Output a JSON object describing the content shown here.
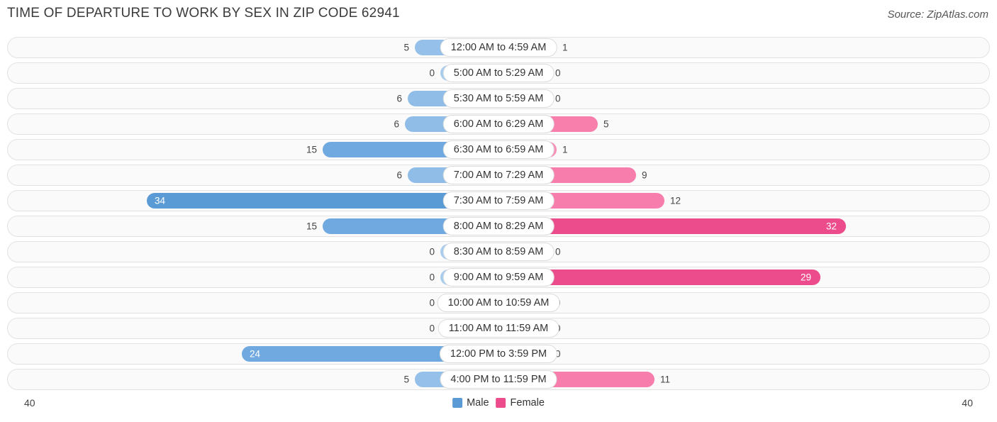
{
  "header": {
    "title": "TIME OF DEPARTURE TO WORK BY SEX IN ZIP CODE 62941",
    "source": "Source: ZipAtlas.com"
  },
  "legend": {
    "male_label": "Male",
    "female_label": "Female",
    "male_color": "#5b9bd5",
    "female_color": "#ed4c8c"
  },
  "axis": {
    "left_max": "40",
    "right_max": "40"
  },
  "chart_data": {
    "type": "bar",
    "subtype": "diverging-bidirectional",
    "title": "TIME OF DEPARTURE TO WORK BY SEX IN ZIP CODE 62941",
    "xlabel": "",
    "ylabel": "",
    "xlim": [
      40,
      40
    ],
    "grid": false,
    "legend_position": "bottom-center",
    "categories": [
      "12:00 AM to 4:59 AM",
      "5:00 AM to 5:29 AM",
      "5:30 AM to 5:59 AM",
      "6:00 AM to 6:29 AM",
      "6:30 AM to 6:59 AM",
      "7:00 AM to 7:29 AM",
      "7:30 AM to 7:59 AM",
      "8:00 AM to 8:29 AM",
      "8:30 AM to 8:59 AM",
      "9:00 AM to 9:59 AM",
      "10:00 AM to 10:59 AM",
      "11:00 AM to 11:59 AM",
      "12:00 PM to 3:59 PM",
      "4:00 PM to 11:59 PM"
    ],
    "series": [
      {
        "name": "Male",
        "color": "#5b9bd5",
        "values": [
          5,
          0,
          6,
          6,
          15,
          6,
          34,
          15,
          0,
          0,
          0,
          0,
          24,
          5
        ]
      },
      {
        "name": "Female",
        "color": "#ed4c8c",
        "values": [
          1,
          0,
          0,
          5,
          1,
          9,
          12,
          32,
          0,
          29,
          0,
          0,
          0,
          11
        ]
      }
    ]
  },
  "rows": [
    {
      "label": "12:00 AM to 4:59 AM",
      "male": "5",
      "female": "1",
      "male_w": 118,
      "female_w": 82,
      "male_color": "#94c0e9",
      "female_color": "#f781ad",
      "male_inside": false,
      "female_inside": false
    },
    {
      "label": "5:00 AM to 5:29 AM",
      "male": "0",
      "female": "0",
      "male_w": 82,
      "female_w": 72,
      "male_color": "#a8cdee",
      "female_color": "#f9a1c3",
      "male_inside": false,
      "female_inside": false
    },
    {
      "label": "5:30 AM to 5:59 AM",
      "male": "6",
      "female": "0",
      "male_w": 128,
      "female_w": 72,
      "male_color": "#8fbde8",
      "female_color": "#f9a1c3",
      "male_inside": false,
      "female_inside": false
    },
    {
      "label": "6:00 AM to 6:29 AM",
      "male": "6",
      "female": "5",
      "male_w": 132,
      "female_w": 140,
      "male_color": "#8fbde8",
      "female_color": "#f87fac",
      "male_inside": false,
      "female_inside": false
    },
    {
      "label": "6:30 AM to 6:59 AM",
      "male": "15",
      "female": "1",
      "male_w": 248,
      "female_w": 82,
      "male_color": "#6fa9e0",
      "female_color": "#f790b9",
      "male_inside": false,
      "female_inside": false
    },
    {
      "label": "7:00 AM to 7:29 AM",
      "male": "6",
      "female": "9",
      "male_w": 128,
      "female_w": 194,
      "male_color": "#8fbde8",
      "female_color": "#f77eac",
      "male_inside": false,
      "female_inside": false
    },
    {
      "label": "7:30 AM to 7:59 AM",
      "male": "34",
      "female": "12",
      "male_w": 496,
      "female_w": 234,
      "male_color": "#5b9bd5",
      "female_color": "#f77eac",
      "male_inside": true,
      "female_inside": false
    },
    {
      "label": "8:00 AM to 8:29 AM",
      "male": "15",
      "female": "32",
      "male_w": 248,
      "female_w": 490,
      "male_color": "#6fa9e0",
      "female_color": "#ed4c8c",
      "male_inside": false,
      "female_inside": true
    },
    {
      "label": "8:30 AM to 8:59 AM",
      "male": "0",
      "female": "0",
      "male_w": 82,
      "female_w": 72,
      "male_color": "#a8cdee",
      "female_color": "#f9a1c3",
      "male_inside": false,
      "female_inside": false
    },
    {
      "label": "9:00 AM to 9:59 AM",
      "male": "0",
      "female": "29",
      "male_w": 82,
      "female_w": 454,
      "male_color": "#a8cdee",
      "female_color": "#ed4c8c",
      "male_inside": false,
      "female_inside": true
    },
    {
      "label": "10:00 AM to 10:59 AM",
      "male": "0",
      "female": "0",
      "male_w": 82,
      "female_w": 72,
      "male_color": "#a8cdee",
      "female_color": "#f9a1c3",
      "male_inside": false,
      "female_inside": false
    },
    {
      "label": "11:00 AM to 11:59 AM",
      "male": "0",
      "female": "0",
      "male_w": 82,
      "female_w": 72,
      "male_color": "#a8cdee",
      "female_color": "#f9a1c3",
      "male_inside": false,
      "female_inside": false
    },
    {
      "label": "12:00 PM to 3:59 PM",
      "male": "24",
      "female": "0",
      "male_w": 362,
      "female_w": 72,
      "male_color": "#6fa9e0",
      "female_color": "#f9a1c3",
      "male_inside": true,
      "female_inside": false
    },
    {
      "label": "4:00 PM to 11:59 PM",
      "male": "5",
      "female": "11",
      "male_w": 118,
      "female_w": 220,
      "male_color": "#94c0e9",
      "female_color": "#f77eac",
      "male_inside": false,
      "female_inside": false
    }
  ]
}
